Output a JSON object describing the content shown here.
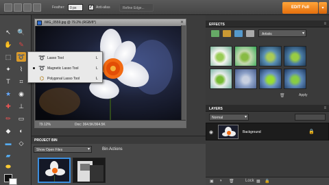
{
  "options_bar": {
    "feather_label": "Feather:",
    "feather_value": "0 px",
    "antialias_label": "Anti-alias",
    "refine_label": "Refine Edge...",
    "edit_full_label": "EDIT Full"
  },
  "document": {
    "title": "IMG_0559.jpg @ 79.2% (RGB/8*)",
    "zoom": "79.12%",
    "doc_size": "Doc: 364.5K/364.5K"
  },
  "flyout": {
    "items": [
      {
        "label": "Lasso Tool",
        "key": "L"
      },
      {
        "label": "Magnetic Lasso Tool",
        "key": "L"
      },
      {
        "label": "Polygonal Lasso Tool",
        "key": "L"
      }
    ]
  },
  "effects": {
    "title": "EFFECTS",
    "category": "Artistic",
    "apply_label": "Apply"
  },
  "layers": {
    "title": "LAYERS",
    "blend_mode": "Normal",
    "layer_name": "Background",
    "lock_label": "Lock"
  },
  "bin": {
    "title": "PROJECT BIN",
    "show_label": "Show Open Files",
    "actions_label": "Bin Actions"
  },
  "colors": {
    "accent": "#f08a1c",
    "active_tool": "#d99a2b"
  }
}
